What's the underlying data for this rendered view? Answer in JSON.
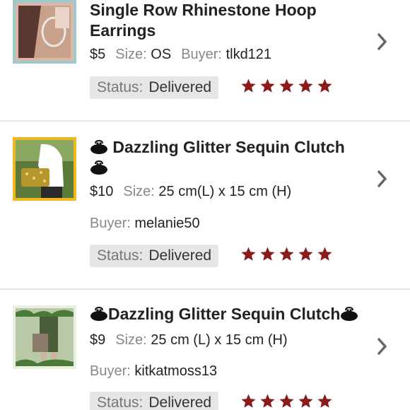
{
  "colors": {
    "star": "#8b1a1a",
    "status_bg": "#e6e6e6",
    "chevron": "#666666"
  },
  "listings": [
    {
      "title": "Single Row Rhinestone Hoop Earrings",
      "price": "$5",
      "size_label": "Size:",
      "size": "OS",
      "buyer_label": "Buyer:",
      "buyer": "tlkd121",
      "status_label": "Status:",
      "status": "Delivered",
      "rating": 5,
      "thumb_icon": "hoop-earrings-photo"
    },
    {
      "title": "Dazzling Glitter Sequin Clutch",
      "price": "$10",
      "size_label": "Size:",
      "size": "25 cm(L) x 15 cm (H)",
      "buyer_label": "Buyer:",
      "buyer": "melanie50",
      "status_label": "Status:",
      "status": "Delivered",
      "rating": 5,
      "thumb_icon": "sequin-clutch-photo"
    },
    {
      "title": "Dazzling Glitter Sequin Clutch",
      "price": "$9",
      "size_label": "Size:",
      "size": "25 cm (L) x 15 cm (H)",
      "buyer_label": "Buyer:",
      "buyer": "kitkatmoss13",
      "status_label": "Status:",
      "status": "Delivered",
      "rating": 5,
      "thumb_icon": "sequin-clutch-photo"
    }
  ]
}
